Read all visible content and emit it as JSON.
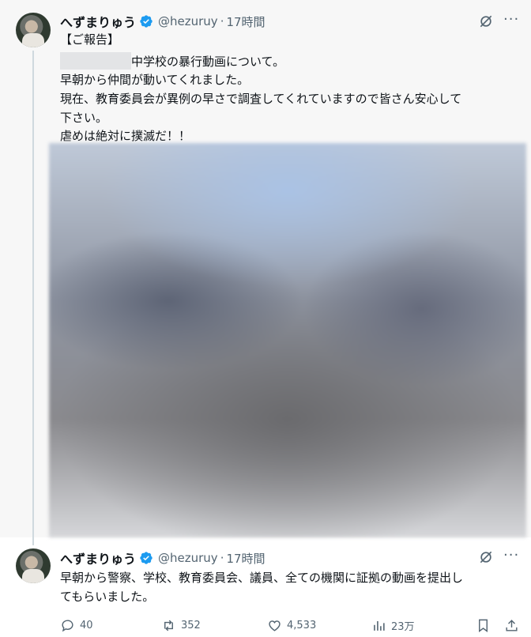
{
  "tweets": [
    {
      "display_name": "へずまりゅう",
      "handle": "@hezuruy",
      "separator": "·",
      "time": "17時間",
      "lines": [
        "【ご報告】",
        "中学校の暴行動画について。",
        "早朝から仲間が動いてくれました。",
        "現在、教育委員会が異例の早さで調査してくれていますので皆さん安心して",
        "下さい。",
        "虐めは絶対に撲滅だ！！"
      ]
    },
    {
      "display_name": "へずまりゅう",
      "handle": "@hezuruy",
      "separator": "·",
      "time": "17時間",
      "lines": [
        "早朝から警察、学校、教育委員会、議員、全ての機関に証拠の動画を提出し",
        "てもらいました。"
      ]
    }
  ],
  "actions": {
    "replies": "40",
    "reposts": "352",
    "likes": "4,533",
    "views": "23万"
  },
  "colors": {
    "verified": "#1d9bf0",
    "secondary_text": "#536471",
    "thread_background": "#f7f7f7"
  },
  "icons": [
    "verified-badge-icon",
    "grok-icon",
    "more-icon",
    "reply-icon",
    "repost-icon",
    "like-icon",
    "views-icon",
    "bookmark-icon",
    "share-icon"
  ]
}
